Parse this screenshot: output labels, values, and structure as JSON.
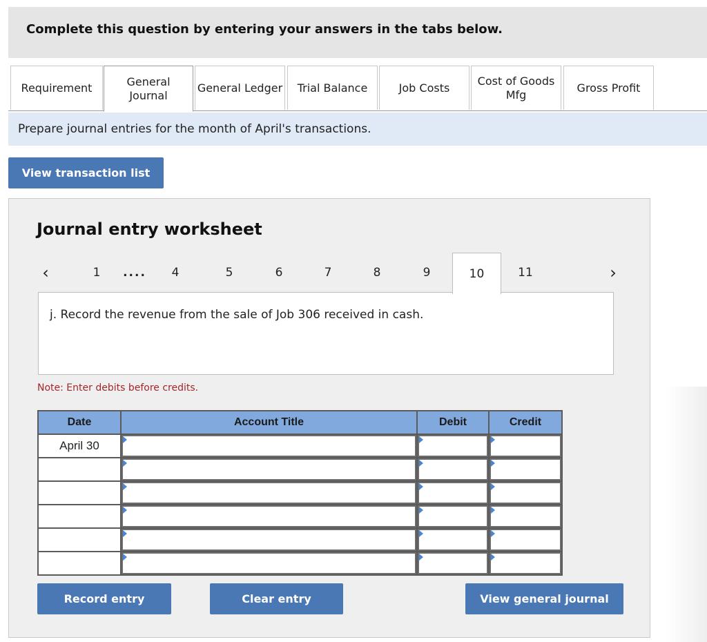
{
  "header": {
    "title": "Complete this question by entering your answers in the tabs below."
  },
  "tabs": [
    {
      "label": "Requirement",
      "active": false
    },
    {
      "label": "General\nJournal",
      "active": true
    },
    {
      "label": "General Ledger",
      "active": false
    },
    {
      "label": "Trial Balance",
      "active": false
    },
    {
      "label": "Job Costs",
      "active": false
    },
    {
      "label": "Cost of Goods\nMfg",
      "active": false
    },
    {
      "label": "Gross Profit",
      "active": false
    }
  ],
  "instruction": "Prepare journal entries for the month of April's transactions.",
  "buttons": {
    "view_transaction_list": "View transaction list",
    "record_entry": "Record entry",
    "clear_entry": "Clear entry",
    "view_general_journal": "View general journal"
  },
  "worksheet": {
    "title": "Journal entry worksheet",
    "pager": {
      "prev_icon": "‹",
      "next_icon": "›",
      "items": [
        "1",
        "....",
        "4",
        "5",
        "6",
        "7",
        "8",
        "9",
        "10",
        "11"
      ],
      "active": "10"
    },
    "description": "j. Record the revenue from the sale of Job 306 received in cash.",
    "note": "Note: Enter debits before credits.",
    "table": {
      "headers": [
        "Date",
        "Account Title",
        "Debit",
        "Credit"
      ],
      "rows": [
        {
          "date": "April 30",
          "account": "",
          "debit": "",
          "credit": ""
        },
        {
          "date": "",
          "account": "",
          "debit": "",
          "credit": ""
        },
        {
          "date": "",
          "account": "",
          "debit": "",
          "credit": ""
        },
        {
          "date": "",
          "account": "",
          "debit": "",
          "credit": ""
        },
        {
          "date": "",
          "account": "",
          "debit": "",
          "credit": ""
        },
        {
          "date": "",
          "account": "",
          "debit": "",
          "credit": ""
        }
      ]
    }
  },
  "colors": {
    "button": "#4a78b5",
    "table_header": "#82a9de",
    "instruction_bg": "#dfeaf6",
    "note_text": "#a5262a"
  }
}
